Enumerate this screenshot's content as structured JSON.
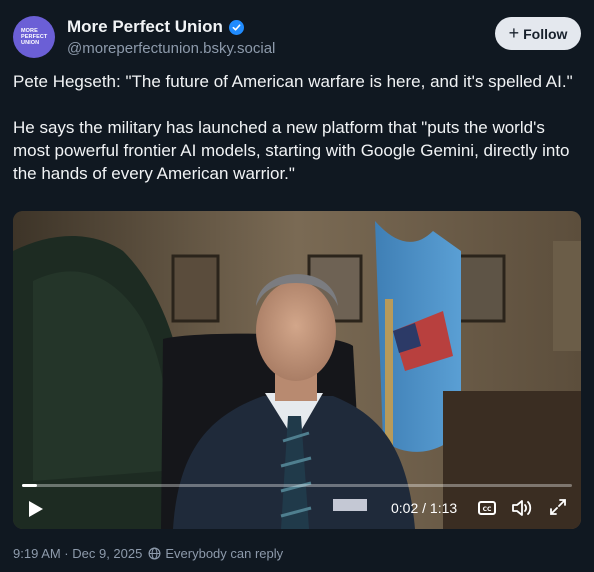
{
  "author": {
    "display_name": "More Perfect Union",
    "handle": "@moreperfectunion.bsky.social",
    "avatar_text": [
      "MORE",
      "PERFECT",
      "UNION"
    ],
    "verified": true,
    "verified_color": "#208bfe",
    "avatar_color": "#6b5fd6"
  },
  "follow_button": {
    "icon": "plus-icon",
    "label": "Follow"
  },
  "post": {
    "paragraphs": [
      "Pete Hegseth: \"The future of American warfare is here, and it's spelled AI.\"",
      "He says the military has launched a new platform that \"puts the world's most powerful frontier AI models, starting with Google Gemini, directly into the hands of every American warrior.\""
    ]
  },
  "video": {
    "current_time": "0:02",
    "duration": "1:13",
    "time_display": "0:02 / 1:13",
    "progress_fraction": 0.027,
    "controls": [
      "play-icon",
      "closed-captions-icon",
      "volume-icon",
      "fullscreen-icon"
    ]
  },
  "footer": {
    "timestamp": "9:19 AM · Dec 9, 2025",
    "reply_setting": "Everybody can reply",
    "reply_icon": "globe-icon"
  },
  "colors": {
    "background": "#101821",
    "text": "#f1f3f5",
    "muted": "#8d9aab"
  }
}
